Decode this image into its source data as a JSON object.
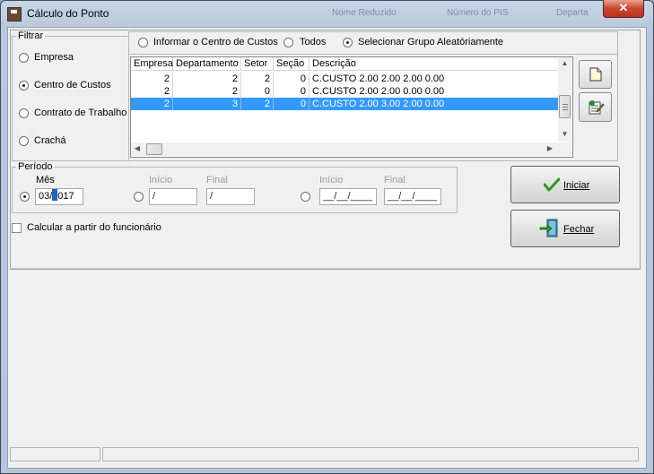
{
  "window": {
    "title": "Cálculo do Ponto",
    "background_title_1": "Nome Reduzido",
    "background_title_2": "Número do PIS",
    "background_title_3": "Departa",
    "close_label": "✕"
  },
  "filtrar": {
    "label": "Filtrar",
    "options": [
      {
        "label": "Empresa",
        "checked": false
      },
      {
        "label": "Centro de Custos",
        "checked": true
      },
      {
        "label": "Contrato de Trabalho",
        "checked": false
      },
      {
        "label": "Crachá",
        "checked": false
      }
    ]
  },
  "centro_custos": {
    "options": [
      {
        "label": "Informar o Centro de Custos",
        "checked": false
      },
      {
        "label": "Todos",
        "checked": false
      },
      {
        "label": "Selecionar Grupo Aleatóriamente",
        "checked": true
      }
    ],
    "columns": [
      "Empresa",
      "Departamento",
      "Setor",
      "Seção",
      "Descrição"
    ],
    "rows": [
      {
        "empresa": "2",
        "departamento": "2",
        "setor": "2",
        "secao": "0",
        "descricao": "C.CUSTO 2.00  2.00  2.00  0.00",
        "selected": false
      },
      {
        "empresa": "2",
        "departamento": "2",
        "setor": "0",
        "secao": "0",
        "descricao": "C.CUSTO 2.00  2.00  0.00  0.00",
        "selected": false
      },
      {
        "empresa": "2",
        "departamento": "3",
        "setor": "2",
        "secao": "0",
        "descricao": "C.CUSTO 2.00  3.00  2.00  0.00",
        "selected": true
      }
    ],
    "new_icon": "new-document-icon",
    "edit_icon": "edit-list-icon"
  },
  "periodo": {
    "label": "Período",
    "mes_label": "Mês",
    "mes_value_before": "03/",
    "mes_value_after": "017",
    "inicio_label": "Início",
    "final_label": "Final",
    "inicio_value": " /",
    "final_value": " /",
    "inicio2_label": "Início",
    "final2_label": "Final",
    "inicio2_value": "__/__/____",
    "final2_value": "__/__/____",
    "selected_option": "mes"
  },
  "calcular_funcionario": {
    "label": "Calcular a partir do funcionário",
    "checked": false
  },
  "buttons": {
    "iniciar": "Iniciar",
    "fechar": "Fechar",
    "iniciar_icon": "check-icon",
    "fechar_icon": "exit-door-icon"
  },
  "colors": {
    "selection": "#3399ff",
    "check_green": "#2e9a1f"
  }
}
